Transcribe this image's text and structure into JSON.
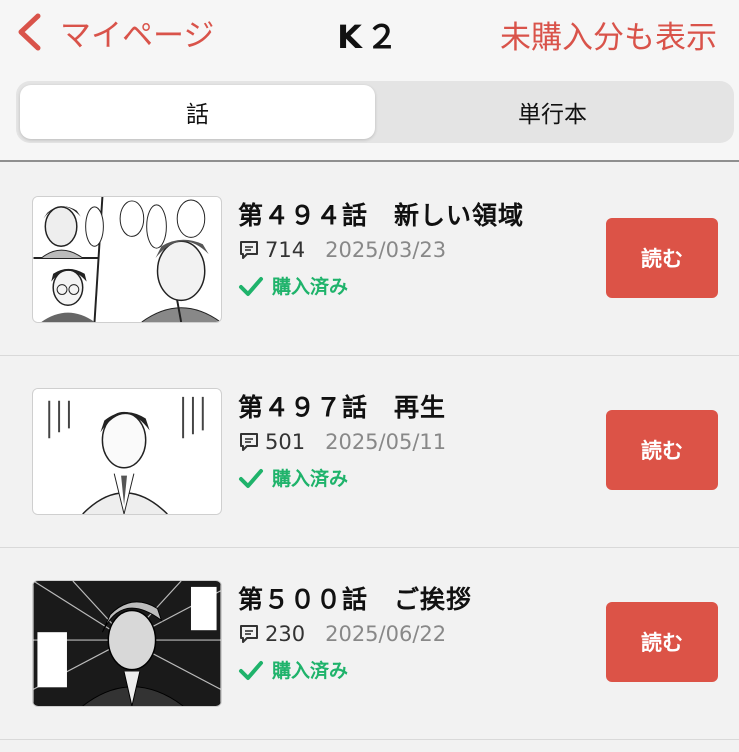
{
  "nav": {
    "back_label": "マイページ",
    "title": "K２",
    "show_unpurchased_label": "未購入分も表示"
  },
  "tabs": [
    {
      "label": "話",
      "active": true
    },
    {
      "label": "単行本",
      "active": false
    }
  ],
  "episodes": [
    {
      "title": "第４９４話　新しい領域",
      "comments": "714",
      "date": "2025/03/23",
      "status": "購入済み",
      "button": "読む"
    },
    {
      "title": "第４９７話　再生",
      "comments": "501",
      "date": "2025/05/11",
      "status": "購入済み",
      "button": "読む"
    },
    {
      "title": "第５００話　ご挨拶",
      "comments": "230",
      "date": "2025/06/22",
      "status": "購入済み",
      "button": "読む"
    }
  ],
  "colors": {
    "accent": "#dc5347",
    "purchased": "#1fb36b",
    "background": "#f2f2f2"
  },
  "icons": {
    "back": "chevron-left-icon",
    "comment": "comment-icon",
    "purchased": "check-icon"
  }
}
